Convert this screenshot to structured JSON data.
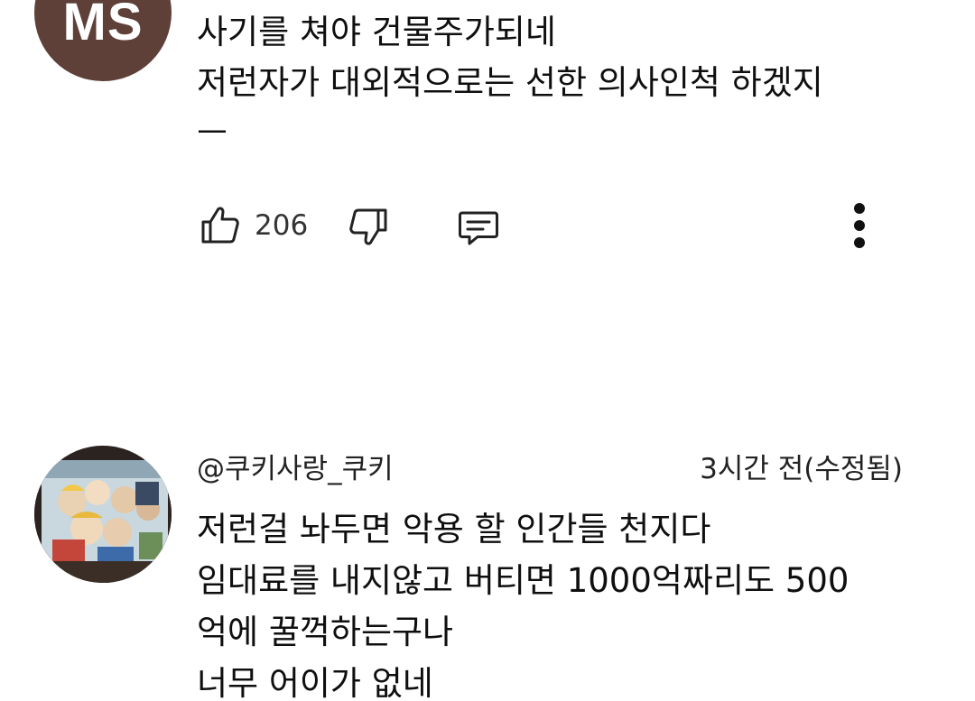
{
  "comment1": {
    "avatar_initials": "MS",
    "lines": [
      "사기를 쳐야 건물주가되네",
      "저런자가 대외적으로는 선한 의사인척 하겠지",
      "ㅡ"
    ],
    "like_count": "206",
    "icons": {
      "like": "thumbs-up-icon",
      "dislike": "thumbs-down-icon",
      "reply": "comment-reply-icon",
      "more": "more-vertical-icon"
    }
  },
  "comment2": {
    "handle": "@쿠키사랑_쿠키",
    "time": "3시간 전(수정됨)",
    "lines": [
      "저런걸 놔두면 악용 할 인간들 천지다",
      "임대료를 내지않고 버티면 1000억짜리도 500",
      "억에 꿀꺽하는구나",
      "너무 어이가 없네"
    ]
  },
  "colors": {
    "avatar1_bg": "#5e4038",
    "text": "#0f0f0f",
    "icon": "#222222"
  }
}
